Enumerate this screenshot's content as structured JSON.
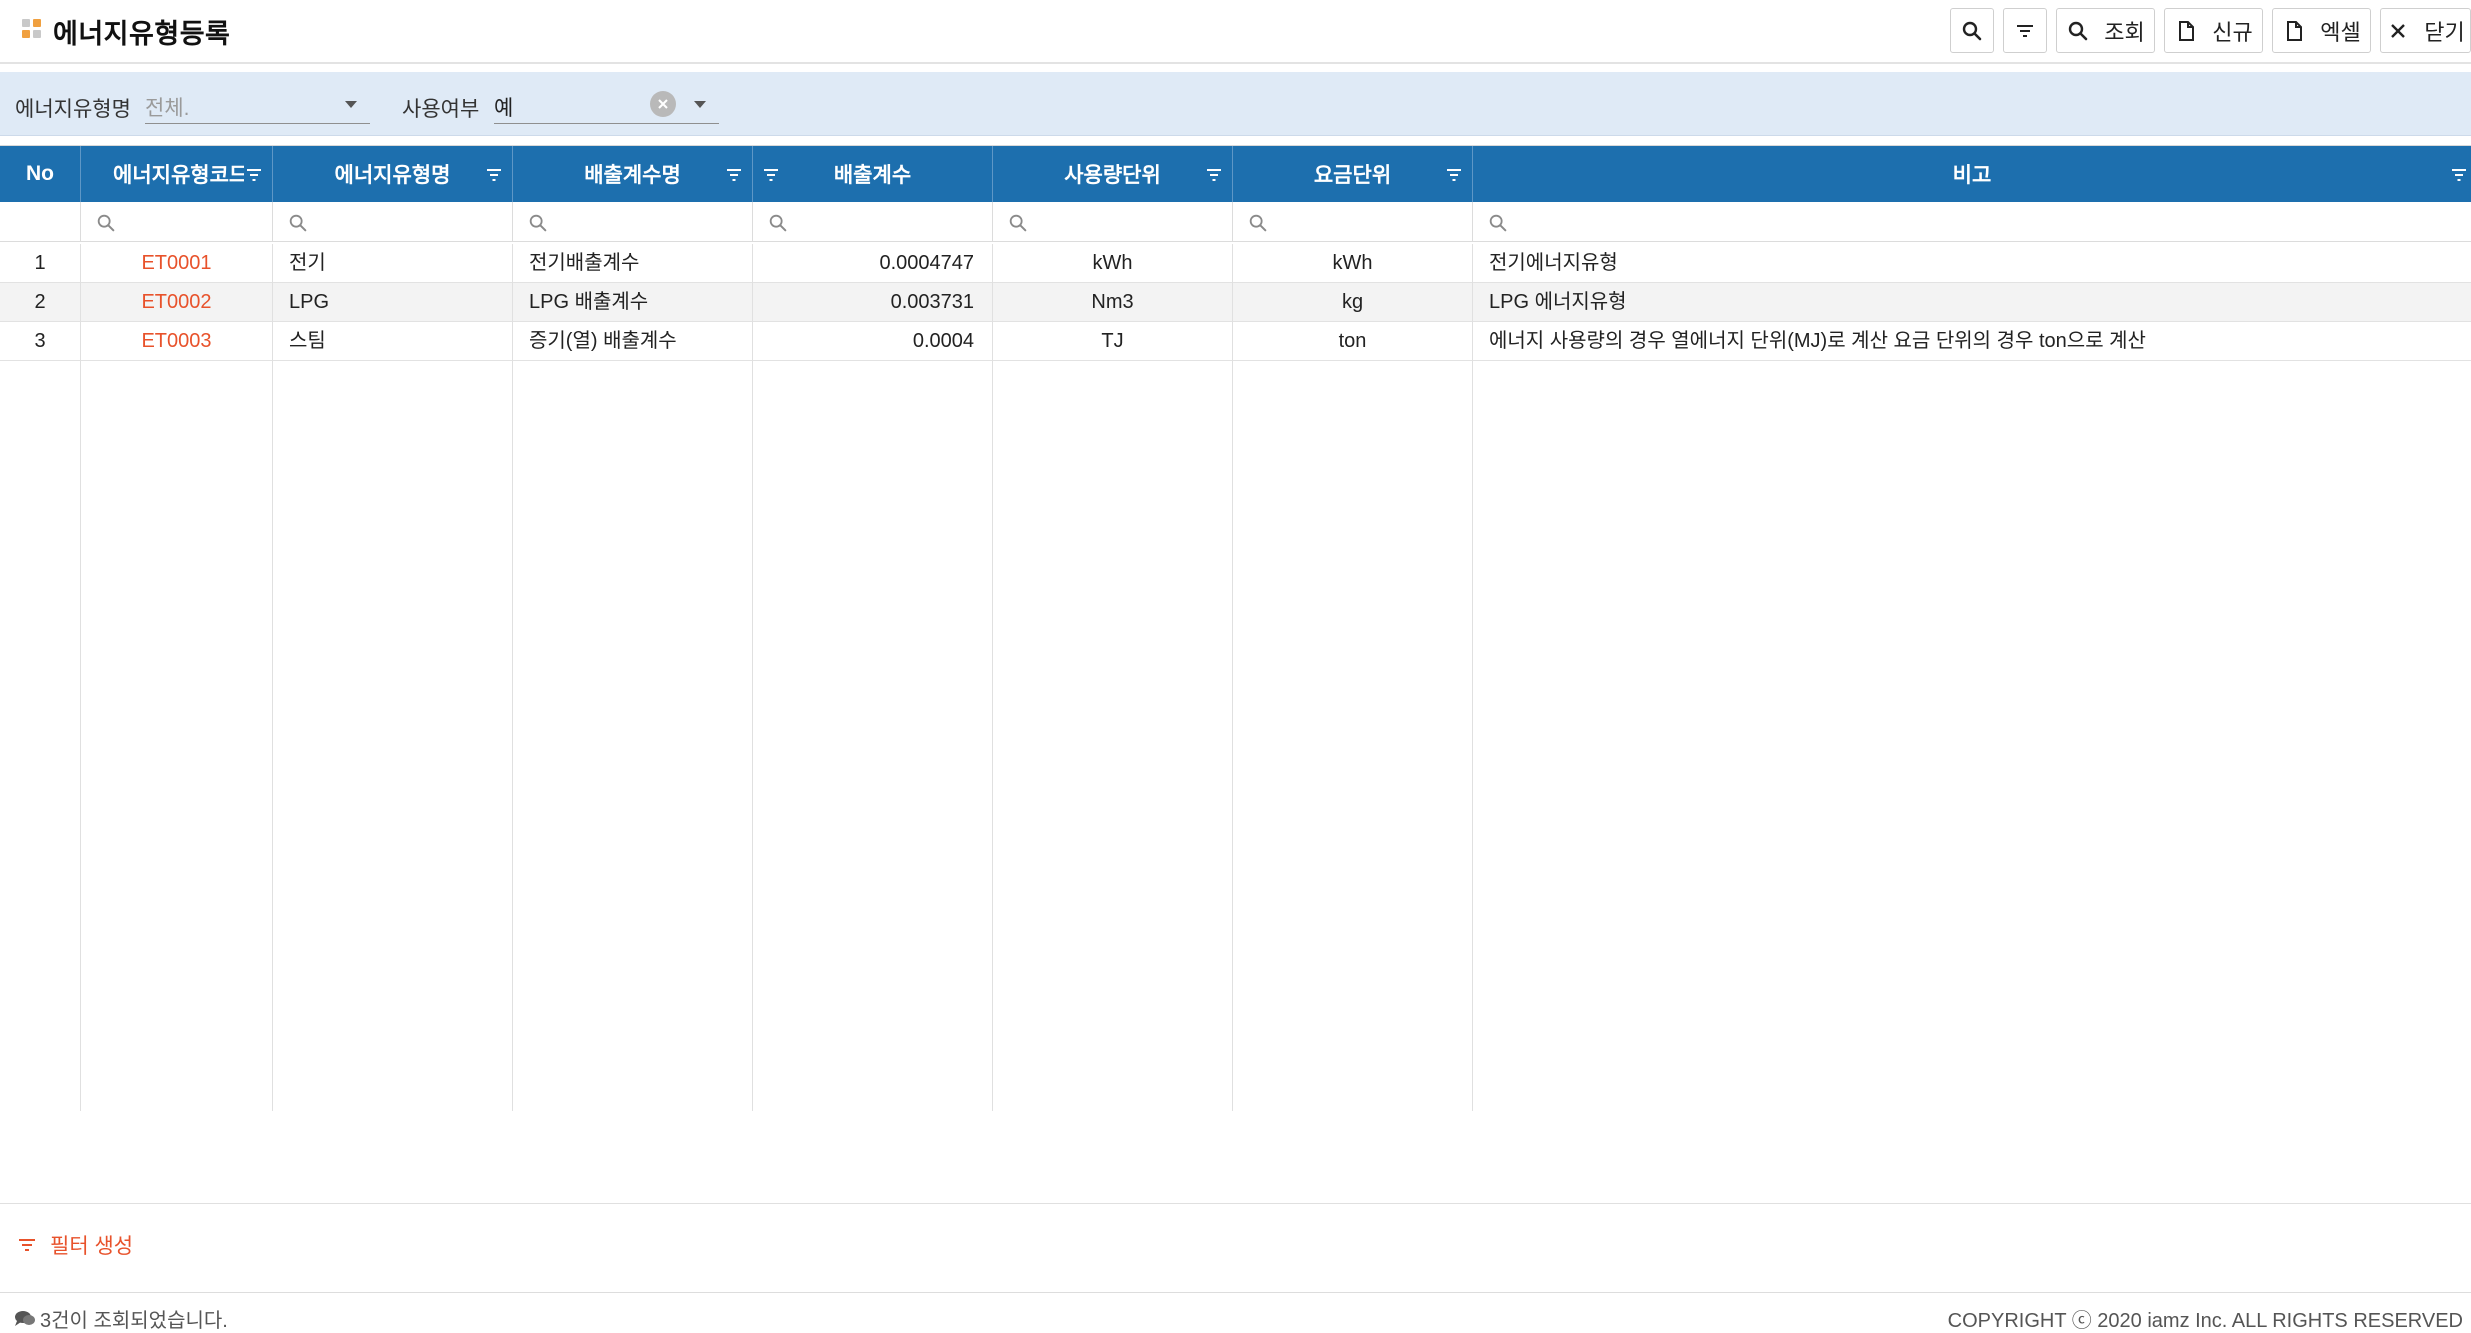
{
  "header": {
    "title": "에너지유형등록",
    "buttons": {
      "search_icon_only": "",
      "filter_icon_only": "",
      "search": "조회",
      "new": "신규",
      "excel": "엑셀",
      "close": "닫기"
    }
  },
  "search": {
    "energy_type_label": "에너지유형명",
    "energy_type_value": "전체.",
    "use_yn_label": "사용여부",
    "use_yn_value": "예"
  },
  "grid": {
    "columns": [
      "No",
      "에너지유형코드",
      "에너지유형명",
      "배출계수명",
      "배출계수",
      "사용량단위",
      "요금단위",
      "비고"
    ],
    "rows": [
      {
        "no": "1",
        "code": "ET0001",
        "name": "전기",
        "factor_name": "전기배출계수",
        "factor": "0.0004747",
        "usage_unit": "kWh",
        "fee_unit": "kWh",
        "note": "전기에너지유형"
      },
      {
        "no": "2",
        "code": "ET0002",
        "name": "LPG",
        "factor_name": "LPG 배출계수",
        "factor": "0.003731",
        "usage_unit": "Nm3",
        "fee_unit": "kg",
        "note": "LPG 에너지유형"
      },
      {
        "no": "3",
        "code": "ET0003",
        "name": "스팀",
        "factor_name": "증기(열) 배출계수",
        "factor": "0.0004",
        "usage_unit": "TJ",
        "fee_unit": "ton",
        "note": "에너지 사용량의 경우 열에너지 단위(MJ)로 계산 요금 단위의 경우 ton으로 계산"
      }
    ]
  },
  "filter_create_label": "필터 생성",
  "footer": {
    "status": "3건이 조회되었습니다.",
    "copyright": "COPYRIGHT ⓒ 2020 iamz Inc. ALL RIGHTS RESERVED"
  },
  "colors": {
    "header_blue": "#1d6fae",
    "search_bg": "#dfeaf6",
    "accent_red": "#e8522b",
    "accent_orange": "#f0a040"
  }
}
